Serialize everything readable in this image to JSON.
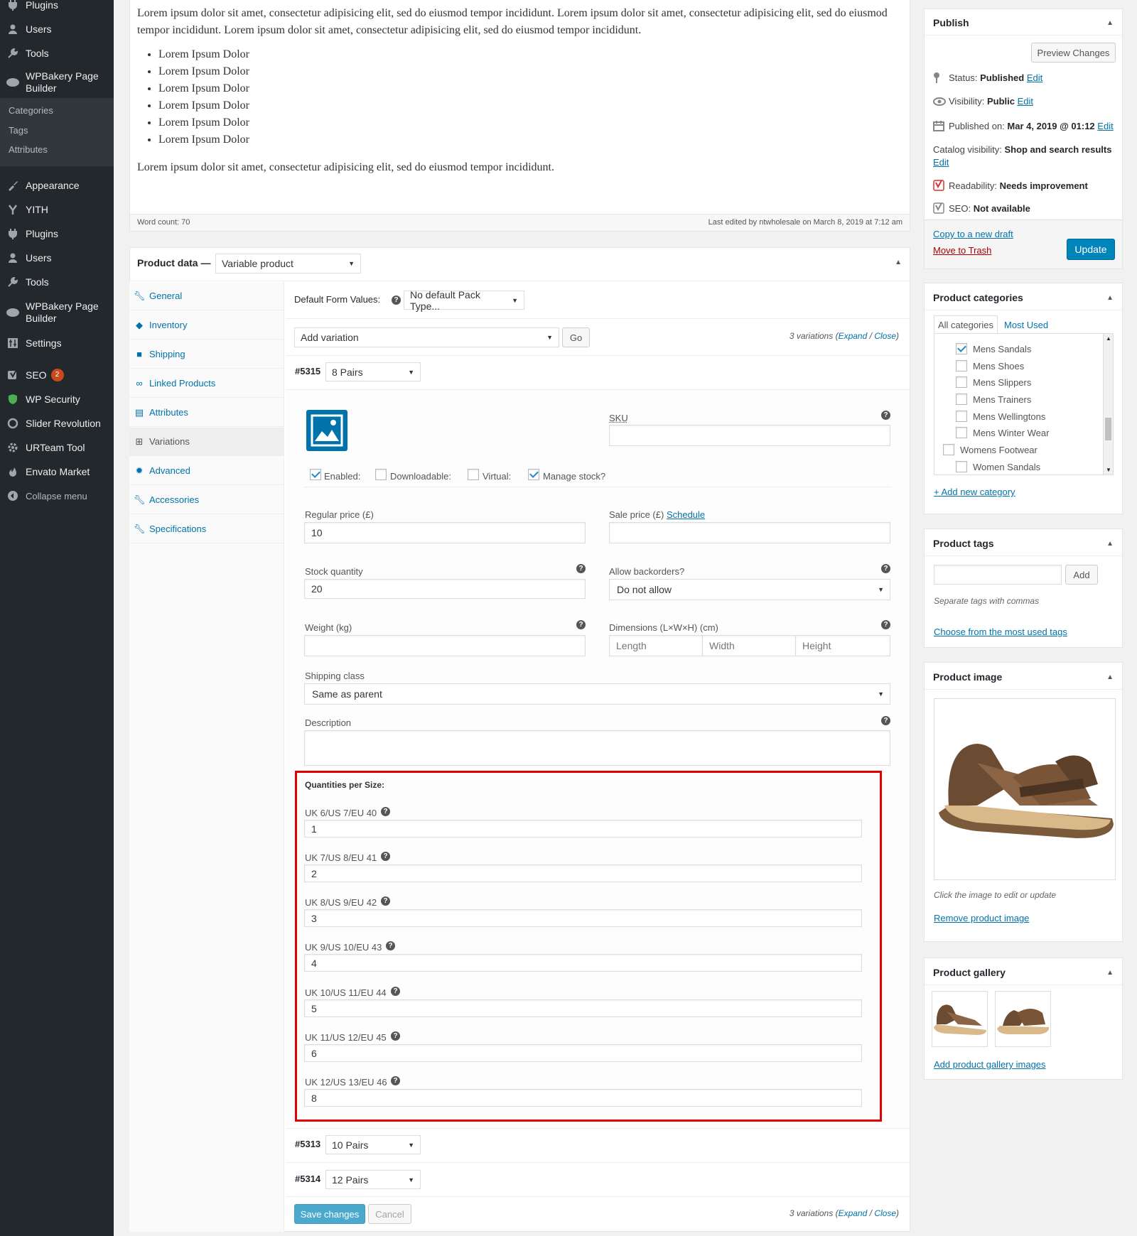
{
  "sidebar": {
    "top_items": [
      {
        "label": "Plugins",
        "icon": "plugin-icon"
      },
      {
        "label": "Users",
        "icon": "users-icon"
      },
      {
        "label": "Tools",
        "icon": "tools-icon"
      },
      {
        "label": "WPBakery Page Builder",
        "icon": "wpbakery-icon"
      }
    ],
    "submenu": [
      "Categories",
      "Tags",
      "Attributes"
    ],
    "items": [
      {
        "label": "Appearance",
        "icon": "appearance-icon"
      },
      {
        "label": "YITH",
        "icon": "yith-icon"
      },
      {
        "label": "Plugins",
        "icon": "plugin-icon"
      },
      {
        "label": "Users",
        "icon": "users-icon"
      },
      {
        "label": "Tools",
        "icon": "tools-icon"
      },
      {
        "label": "WPBakery Page Builder",
        "icon": "wpbakery-icon"
      },
      {
        "label": "Settings",
        "icon": "settings-icon"
      },
      {
        "label": "SEO",
        "icon": "seo-icon",
        "badge": "2"
      },
      {
        "label": "WP Security",
        "icon": "shield-icon"
      },
      {
        "label": "Slider Revolution",
        "icon": "slider-icon"
      },
      {
        "label": "URTeam Tool",
        "icon": "gear-icon"
      },
      {
        "label": "Envato Market",
        "icon": "envato-icon"
      },
      {
        "label": "Collapse menu",
        "icon": "collapse-icon"
      }
    ]
  },
  "editor": {
    "paragraph1": "Lorem ipsum dolor sit amet, consectetur adipisicing elit, sed do eiusmod tempor incididunt. Lorem ipsum dolor sit amet, consectetur adipisicing elit, sed do eiusmod tempor incididunt. Lorem ipsum dolor sit amet, consectetur adipisicing elit, sed do eiusmod tempor incididunt.",
    "list": [
      "Lorem Ipsum Dolor",
      "Lorem Ipsum Dolor",
      "Lorem Ipsum Dolor",
      "Lorem Ipsum Dolor",
      "Lorem Ipsum Dolor",
      "Lorem Ipsum Dolor"
    ],
    "paragraph2": "Lorem ipsum dolor sit amet, consectetur adipisicing elit, sed do eiusmod tempor incididunt.",
    "word_count": "Word count: 70",
    "last_edited": "Last edited by ntwholesale on March 8, 2019 at 7:12 am"
  },
  "product_data": {
    "label": "Product data —",
    "type": "Variable product",
    "tabs": [
      {
        "label": "General",
        "icon": "wrench-icon"
      },
      {
        "label": "Inventory",
        "icon": "tag-icon"
      },
      {
        "label": "Shipping",
        "icon": "truck-icon"
      },
      {
        "label": "Linked Products",
        "icon": "link-icon"
      },
      {
        "label": "Attributes",
        "icon": "list-icon"
      },
      {
        "label": "Variations",
        "icon": "grid-icon"
      },
      {
        "label": "Advanced",
        "icon": "gear-icon"
      },
      {
        "label": "Accessories",
        "icon": "wrench-icon"
      },
      {
        "label": "Specifications",
        "icon": "wrench-icon"
      }
    ],
    "default_form_label": "Default Form Values:",
    "default_form_value": "No default Pack Type...",
    "add_variation": "Add variation",
    "go": "Go",
    "variations_count": "3 variations",
    "expand": "Expand",
    "sep": "/",
    "close": "Close",
    "variations": [
      {
        "id": "#5315",
        "value": "8 Pairs"
      },
      {
        "id": "#5313",
        "value": "10 Pairs"
      },
      {
        "id": "#5314",
        "value": "12 Pairs"
      }
    ],
    "sku_label": "SKU",
    "checks": [
      {
        "label": "Enabled:",
        "checked": true
      },
      {
        "label": "Downloadable:",
        "checked": false
      },
      {
        "label": "Virtual:",
        "checked": false
      },
      {
        "label": "Manage stock?",
        "checked": true
      }
    ],
    "regular_price_label": "Regular price (£)",
    "regular_price": "10",
    "sale_price_label": "Sale price (£)",
    "schedule": "Schedule",
    "stock_label": "Stock quantity",
    "stock": "20",
    "backorders_label": "Allow backorders?",
    "backorders": "Do not allow",
    "weight_label": "Weight (kg)",
    "dimensions_label": "Dimensions (L×W×H) (cm)",
    "length": "Length",
    "width": "Width",
    "height": "Height",
    "shipping_class_label": "Shipping class",
    "shipping_class": "Same as parent",
    "description_label": "Description",
    "qty_title": "Quantities per Size:",
    "sizes": [
      {
        "label": "UK 6/US 7/EU 40",
        "value": "1"
      },
      {
        "label": "UK 7/US 8/EU 41",
        "value": "2"
      },
      {
        "label": "UK 8/US 9/EU 42",
        "value": "3"
      },
      {
        "label": "UK 9/US 10/EU 43",
        "value": "4"
      },
      {
        "label": "UK 10/US 11/EU 44",
        "value": "5"
      },
      {
        "label": "UK 11/US 12/EU 45",
        "value": "6"
      },
      {
        "label": "UK 12/US 13/EU 46",
        "value": "8"
      }
    ],
    "save": "Save changes",
    "cancel": "Cancel"
  },
  "publish": {
    "title": "Publish",
    "preview": "Preview Changes",
    "status_label": "Status:",
    "status": "Published",
    "visibility_label": "Visibility:",
    "visibility": "Public",
    "published_label": "Published on:",
    "published": "Mar 4, 2019 @ 01:12",
    "catalog_label": "Catalog visibility:",
    "catalog": "Shop and search results",
    "readability_label": "Readability:",
    "readability": "Needs improvement",
    "seo_label": "SEO:",
    "seo": "Not available",
    "edit": "Edit",
    "copy": "Copy to a new draft",
    "trash": "Move to Trash",
    "update": "Update"
  },
  "categories": {
    "title": "Product categories",
    "tab_all": "All categories",
    "tab_most": "Most Used",
    "items": [
      {
        "label": "Mens Sandals",
        "checked": true,
        "indent": true
      },
      {
        "label": "Mens Shoes",
        "checked": false,
        "indent": true
      },
      {
        "label": "Mens Slippers",
        "checked": false,
        "indent": true
      },
      {
        "label": "Mens Trainers",
        "checked": false,
        "indent": true
      },
      {
        "label": "Mens Wellingtons",
        "checked": false,
        "indent": true
      },
      {
        "label": "Mens Winter Wear",
        "checked": false,
        "indent": true
      },
      {
        "label": "Womens Footwear",
        "checked": false,
        "indent": false
      },
      {
        "label": "Women Sandals",
        "checked": false,
        "indent": true
      }
    ],
    "add_new": "+ Add new category"
  },
  "tags": {
    "title": "Product tags",
    "add": "Add",
    "hint": "Separate tags with commas",
    "choose": "Choose from the most used tags"
  },
  "image": {
    "title": "Product image",
    "hint": "Click the image to edit or update",
    "remove": "Remove product image"
  },
  "gallery": {
    "title": "Product gallery",
    "add": "Add product gallery images"
  },
  "colors": {
    "sidebar": "#23282d",
    "link": "#0073aa",
    "primary": "#0085ba",
    "highlight": "#e00000",
    "trash": "#a00"
  }
}
